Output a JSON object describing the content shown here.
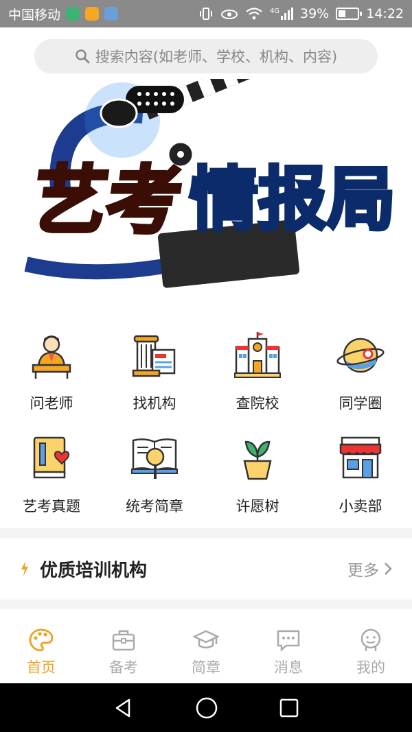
{
  "status": {
    "carrier": "中国移动",
    "network": "4G",
    "battery_percent": "39%",
    "battery_level": 0.39,
    "time": "14:22"
  },
  "search": {
    "placeholder": "搜索内容(如老师、学校、机构、内容)"
  },
  "banner": {
    "title_part1": "艺考",
    "title_part2": "情报局"
  },
  "categories": [
    {
      "label": "问老师",
      "icon": "teacher-icon"
    },
    {
      "label": "找机构",
      "icon": "institution-icon"
    },
    {
      "label": "查院校",
      "icon": "school-building-icon"
    },
    {
      "label": "同学圈",
      "icon": "planet-icon"
    },
    {
      "label": "艺考真题",
      "icon": "book-heart-icon"
    },
    {
      "label": "统考简章",
      "icon": "magnifier-book-icon"
    },
    {
      "label": "许愿树",
      "icon": "plant-pot-icon"
    },
    {
      "label": "小卖部",
      "icon": "shop-icon"
    }
  ],
  "section": {
    "title": "优质培训机构",
    "more": "更多"
  },
  "tabs": [
    {
      "label": "首页",
      "icon": "palette-icon",
      "active": true
    },
    {
      "label": "备考",
      "icon": "briefcase-icon",
      "active": false
    },
    {
      "label": "简章",
      "icon": "graduation-cap-icon",
      "active": false
    },
    {
      "label": "消息",
      "icon": "message-icon",
      "active": false
    },
    {
      "label": "我的",
      "icon": "profile-icon",
      "active": false
    }
  ],
  "colors": {
    "accent": "#f0a020",
    "status_bar": "#8a8a8a",
    "inactive": "#aaaaaa"
  }
}
